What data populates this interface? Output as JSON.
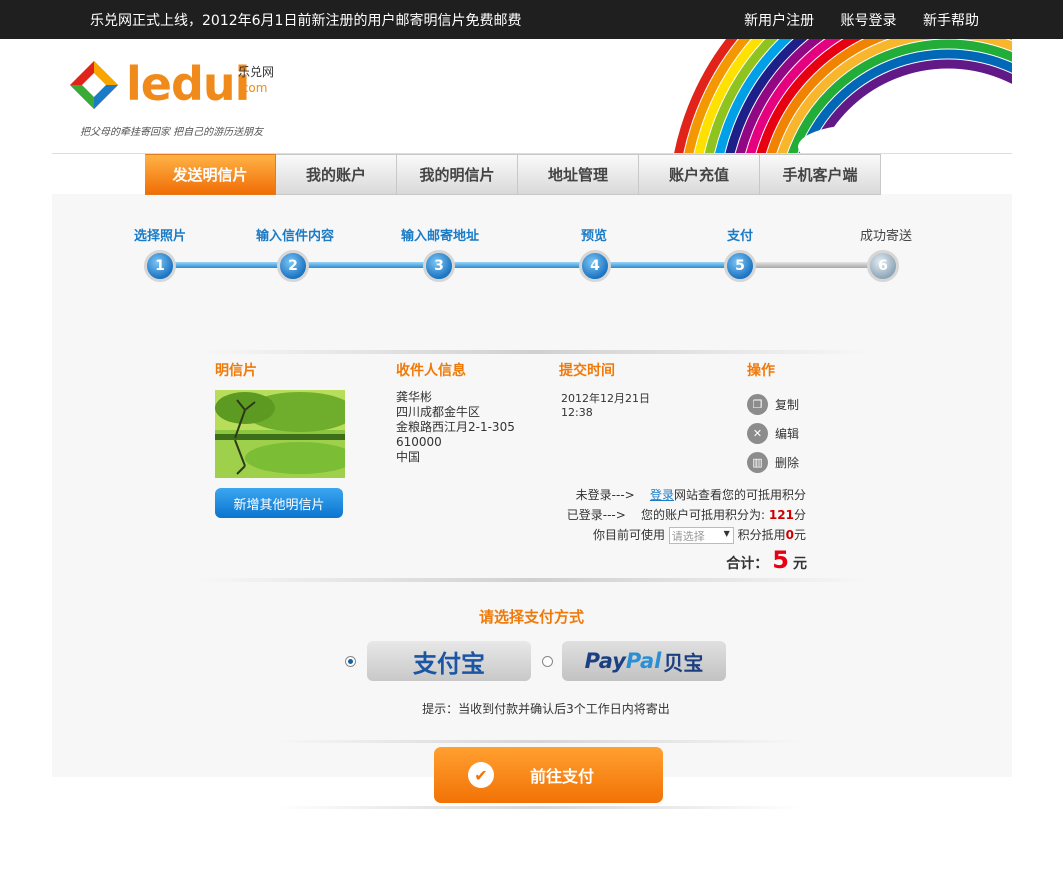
{
  "topbar": {
    "notice": "乐兑网正式上线，2012年6月1日前新注册的用户邮寄明信片免费邮费",
    "links": [
      "新用户注册",
      "账号登录",
      "新手帮助"
    ]
  },
  "logo": {
    "brand": "ledui",
    "cn": "乐兑网",
    "com": ".com",
    "slogan": "把父母的牵挂寄回家 把自己的游历送朋友"
  },
  "nav": {
    "items": [
      "发送明信片",
      "我的账户",
      "我的明信片",
      "地址管理",
      "账户充值",
      "手机客户端"
    ],
    "active": 0
  },
  "steps": [
    {
      "label": "选择照片",
      "num": "1"
    },
    {
      "label": "输入信件内容",
      "num": "2"
    },
    {
      "label": "输入邮寄地址",
      "num": "3"
    },
    {
      "label": "预览",
      "num": "4"
    },
    {
      "label": "支付",
      "num": "5"
    },
    {
      "label": "成功寄送",
      "num": "6"
    }
  ],
  "order": {
    "headers": {
      "postcard": "明信片",
      "recipient": "收件人信息",
      "time": "提交时间",
      "ops": "操作"
    },
    "add_button": "新增其他明信片",
    "recipient": {
      "name": "龚华彬",
      "line1": "四川成都金牛区",
      "line2": "金粮路西江月2-1-305",
      "zip": "610000",
      "country": "中国"
    },
    "submit_date": "2012年12月21日",
    "submit_time": "12:38",
    "ops": {
      "copy": "复制",
      "edit": "编辑",
      "delete": "删除"
    }
  },
  "points": {
    "not_logged_prefix": "未登录--->",
    "login_link": "登录",
    "not_logged_suffix": "网站查看您的可抵用积分",
    "logged_prefix": "已登录--->",
    "logged_text": "您的账户可抵用积分为:",
    "points_value": "121",
    "points_unit": "分",
    "use_prefix": "你目前可使用",
    "select_placeholder": "请选择",
    "use_mid": "积分抵用",
    "deduct_value": "0",
    "deduct_unit": "元"
  },
  "total": {
    "label": "合计：",
    "amount": "5",
    "unit": "元"
  },
  "payment": {
    "title": "请选择支付方式",
    "alipay": "支付宝",
    "paypal_a": "Pay",
    "paypal_b": "Pal",
    "paypal_cn": "贝宝",
    "tip": "提示：当收到付款并确认后3个工作日内将寄出",
    "go_button": "前往支付"
  },
  "colors": {
    "accent": "#ef7a0a",
    "link": "#1a7bc6",
    "price": "#e60012"
  }
}
